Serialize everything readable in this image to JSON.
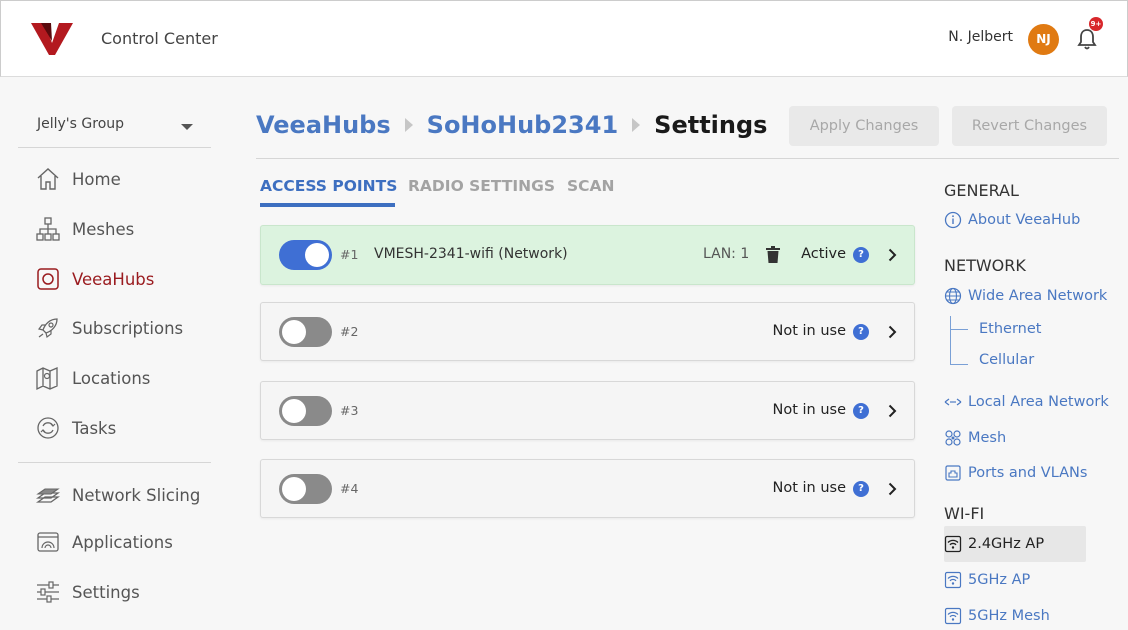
{
  "header": {
    "app_title": "Control Center",
    "user_name": "N. Jelbert",
    "avatar_initials": "NJ",
    "notification_badge": "9+",
    "logo_color": "#b3191f"
  },
  "sidebar": {
    "group": "Jelly's Group",
    "items": [
      {
        "label": "Home",
        "icon": "home-icon"
      },
      {
        "label": "Meshes",
        "icon": "mesh-tree-icon"
      },
      {
        "label": "VeeaHubs",
        "icon": "veeahub-icon",
        "active": true
      },
      {
        "label": "Subscriptions",
        "icon": "rocket-icon"
      },
      {
        "label": "Locations",
        "icon": "map-icon"
      },
      {
        "label": "Tasks",
        "icon": "refresh-icon"
      },
      {
        "label": "Network Slicing",
        "icon": "layers-icon"
      },
      {
        "label": "Applications",
        "icon": "applications-icon"
      },
      {
        "label": "Settings",
        "icon": "sliders-icon"
      }
    ]
  },
  "breadcrumb": {
    "level1": "VeeaHubs",
    "level2": "SoHoHub2341",
    "current": "Settings"
  },
  "actions": {
    "apply": "Apply Changes",
    "revert": "Revert Changes"
  },
  "tabs": [
    {
      "label": "ACCESS POINTS",
      "active": true
    },
    {
      "label": "RADIO SETTINGS"
    },
    {
      "label": "SCAN"
    }
  ],
  "access_points": [
    {
      "num": "#1",
      "name": "VMESH-2341-wifi (Network)",
      "lan": "LAN: 1",
      "status": "Active",
      "enabled": true
    },
    {
      "num": "#2",
      "name": "",
      "lan": "",
      "status": "Not in use",
      "enabled": false
    },
    {
      "num": "#3",
      "name": "",
      "lan": "",
      "status": "Not in use",
      "enabled": false
    },
    {
      "num": "#4",
      "name": "",
      "lan": "",
      "status": "Not in use",
      "enabled": false
    }
  ],
  "help_glyph": "?",
  "right_nav": {
    "general_heading": "GENERAL",
    "about": "About VeeaHub",
    "network_heading": "NETWORK",
    "wan": "Wide Area Network",
    "ethernet": "Ethernet",
    "cellular": "Cellular",
    "lan": "Local Area Network",
    "mesh": "Mesh",
    "ports": "Ports and VLANs",
    "wifi_heading": "WI-FI",
    "ap24": "2.4GHz AP",
    "ap5": "5GHz AP",
    "mesh5": "5GHz Mesh"
  },
  "colors": {
    "accent": "#3d6fc0",
    "brand_red": "#9a1b1f",
    "active_row": "#dcf3df",
    "avatar": "#e07a12"
  }
}
